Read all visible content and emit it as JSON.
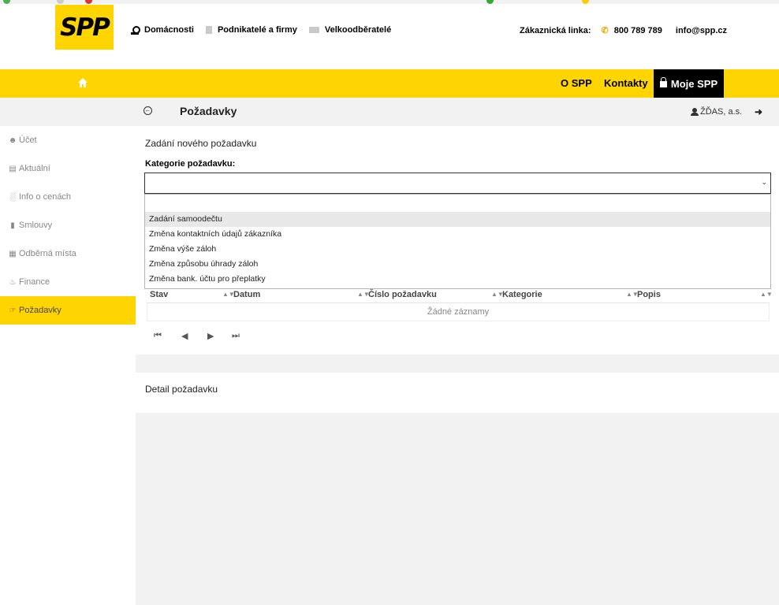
{
  "brand": {
    "logo_text": "SPP",
    "accent": "#ffd500"
  },
  "header": {
    "segments": [
      "Domácnosti",
      "Podnikatelé a firmy",
      "Velkoodběratelé"
    ],
    "contact_label": "Zákaznická linka:",
    "phone": "800 789 789",
    "email": "info@spp.cz"
  },
  "nav": {
    "about": "O SPP",
    "contacts": "Kontakty",
    "account": "Moje SPP"
  },
  "page": {
    "title": "Požadavky",
    "user": "ŽĎAS, a.s."
  },
  "sidebar": {
    "items": [
      {
        "label": "Účet",
        "icon": "user-icon"
      },
      {
        "label": "Aktuální",
        "icon": "calendar-icon"
      },
      {
        "label": "Info o cenách",
        "icon": "bar-chart-icon"
      },
      {
        "label": "Smlouvy",
        "icon": "document-icon"
      },
      {
        "label": "Odběrná místa",
        "icon": "grid-icon"
      },
      {
        "label": "Finance",
        "icon": "piggy-bank-icon"
      },
      {
        "label": "Požadavky",
        "icon": "hand-pointer-icon",
        "active": true
      }
    ]
  },
  "form": {
    "section_title": "Zadání nového požadavku",
    "category_label": "Kategorie požadavku:",
    "category_value": "",
    "options": [
      "",
      "Zadání samoodečtu",
      "Změna kontaktních údajů zákazníka",
      "Změna výše záloh",
      "Změna způsobu úhrady záloh",
      "Změna bank. účtu pro přeplatky"
    ]
  },
  "table": {
    "columns": [
      "Stav",
      "Datum",
      "Číslo požadavku",
      "Kategorie",
      "Popis"
    ],
    "empty_text": "Žádné záznamy"
  },
  "detail": {
    "title": "Detail požadavku"
  }
}
